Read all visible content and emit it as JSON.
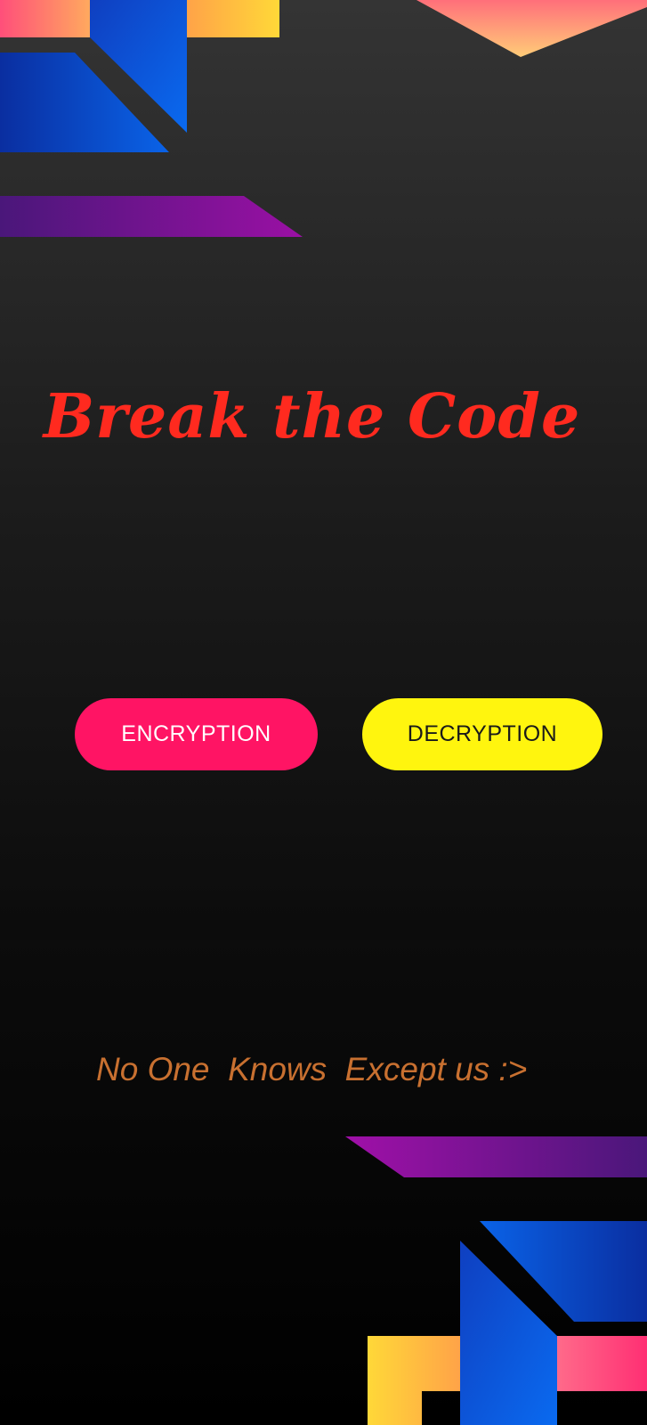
{
  "app": {
    "title": "Break the Code",
    "tagline": "No One  Knows  Except us :>"
  },
  "actions": {
    "encryption_label": "ENCRYPTION",
    "decryption_label": "DECRYPTION"
  },
  "colors": {
    "title": "#ff2a1f",
    "encryption_button": "#ff1464",
    "decryption_button": "#fff50e",
    "tagline": "#c87030",
    "background_top": "#343434",
    "background_bottom": "#000000"
  }
}
